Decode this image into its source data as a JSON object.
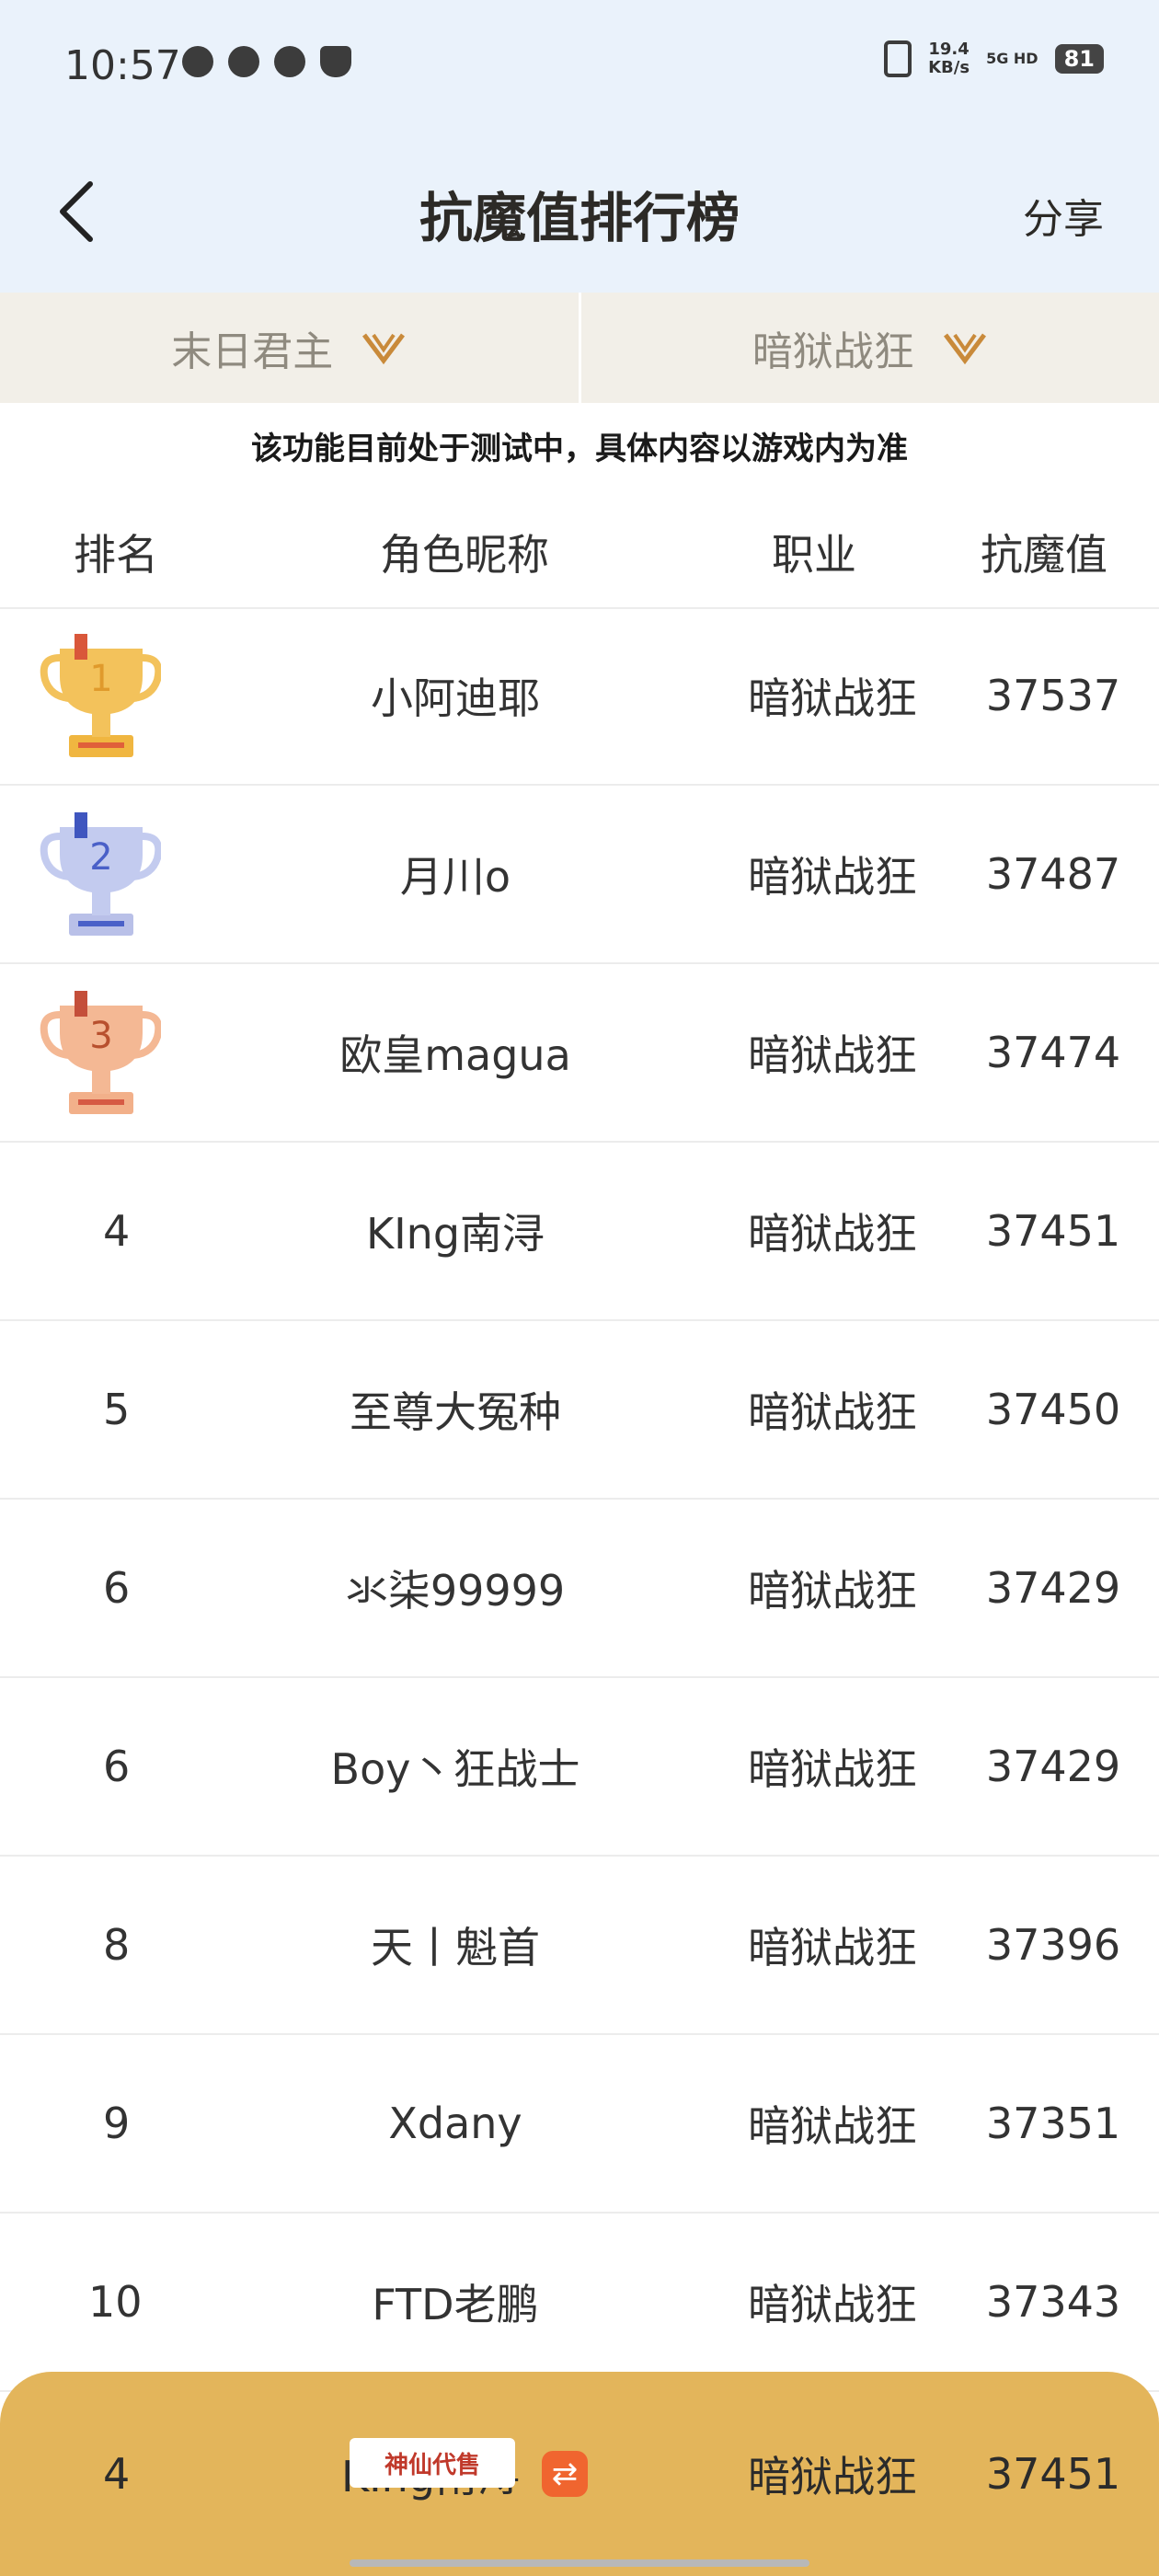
{
  "status_bar": {
    "time": "10:57",
    "net_speed_value": "19.4",
    "net_speed_unit": "KB/s",
    "network": "5G HD",
    "battery": "81"
  },
  "header": {
    "title": "抗魔值排行榜",
    "share_label": "分享"
  },
  "filters": {
    "server": "末日君主",
    "class": "暗狱战狂"
  },
  "notice": "该功能目前处于测试中，具体内容以游戏内为准",
  "table": {
    "columns": [
      "排名",
      "角色昵称",
      "职业",
      "抗魔值"
    ],
    "rows": [
      {
        "rank": "1",
        "name": "小阿迪耶",
        "class": "暗狱战狂",
        "score": "37537"
      },
      {
        "rank": "2",
        "name": "月川o",
        "class": "暗狱战狂",
        "score": "37487"
      },
      {
        "rank": "3",
        "name": "欧皇magua",
        "class": "暗狱战狂",
        "score": "37474"
      },
      {
        "rank": "4",
        "name": "KIng南浔",
        "class": "暗狱战狂",
        "score": "37451"
      },
      {
        "rank": "5",
        "name": "至尊大冤种",
        "class": "暗狱战狂",
        "score": "37450"
      },
      {
        "rank": "6",
        "name": "氺柒99999",
        "class": "暗狱战狂",
        "score": "37429"
      },
      {
        "rank": "6",
        "name": "Boy丶狂战士",
        "class": "暗狱战狂",
        "score": "37429"
      },
      {
        "rank": "8",
        "name": "天丨魁首",
        "class": "暗狱战狂",
        "score": "37396"
      },
      {
        "rank": "9",
        "name": "Xdany",
        "class": "暗狱战狂",
        "score": "37351"
      },
      {
        "rank": "10",
        "name": "FTD老鹏",
        "class": "暗狱战狂",
        "score": "37343"
      }
    ]
  },
  "my_rank": {
    "rank": "4",
    "name": "KIng南浔",
    "class": "暗狱战狂",
    "score": "37451"
  },
  "watermark": "神仙代售",
  "colors": {
    "header_bg": "#eaf2fb",
    "filter_bg": "#f2efe8",
    "my_rank_bg": "#e3b55b",
    "gold": "#f0b640",
    "silver": "#a9b2e0",
    "bronze": "#eda277",
    "accent_icon": "#f0652f"
  }
}
